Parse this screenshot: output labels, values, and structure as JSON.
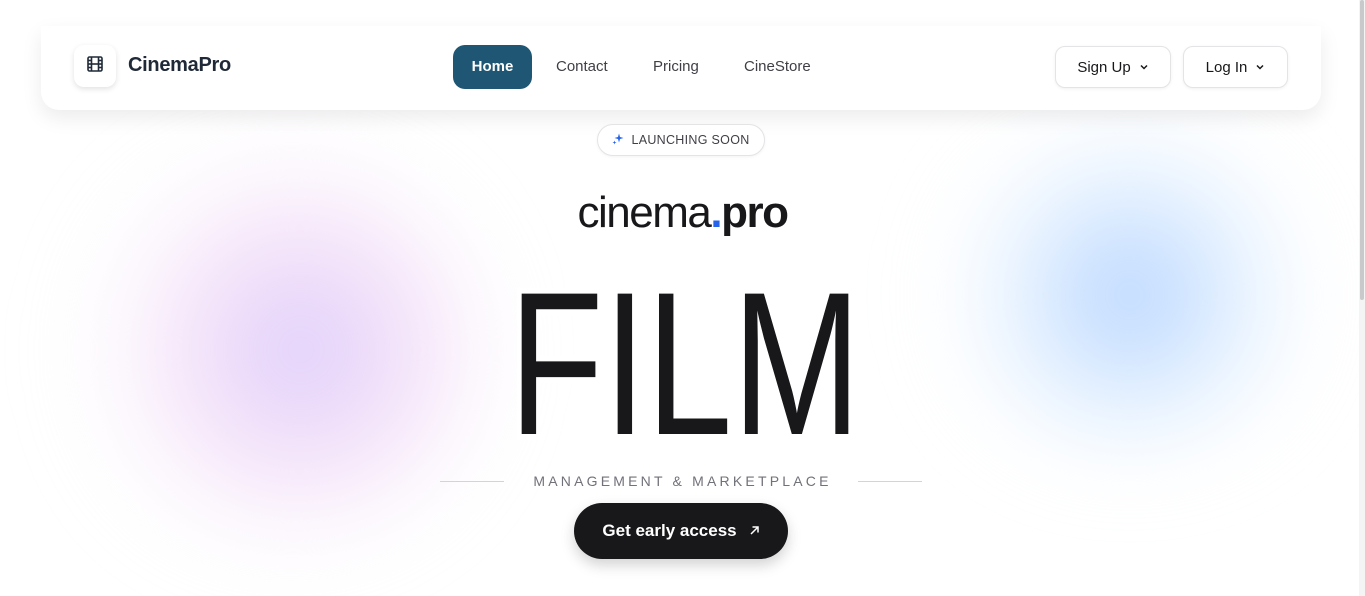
{
  "brand": {
    "name": "CinemaPro",
    "logo_icon": "film-icon"
  },
  "nav": {
    "items": [
      {
        "label": "Home",
        "active": true
      },
      {
        "label": "Contact",
        "active": false
      },
      {
        "label": "Pricing",
        "active": false
      },
      {
        "label": "CineStore",
        "active": false
      }
    ],
    "active_color": "#1e5673"
  },
  "auth": {
    "signup_label": "Sign Up",
    "login_label": "Log In",
    "dropdown_icon": "chevron-down-icon"
  },
  "hero": {
    "badge": {
      "icon": "sparkle-icon",
      "label": "LAUNCHING SOON",
      "icon_color": "#2563eb"
    },
    "wordmark": {
      "name": "cinema",
      "dot": ".",
      "tld": "pro",
      "dot_color": "#2563eb"
    },
    "headline": "FILM",
    "tagline": "MANAGEMENT & MARKETPLACE",
    "cta": {
      "label": "Get early access",
      "icon": "arrow-up-right-icon"
    }
  },
  "colors": {
    "blob_left": "#e4d4fa",
    "blob_right": "#c6dcff",
    "cta_bg": "#18181b"
  }
}
